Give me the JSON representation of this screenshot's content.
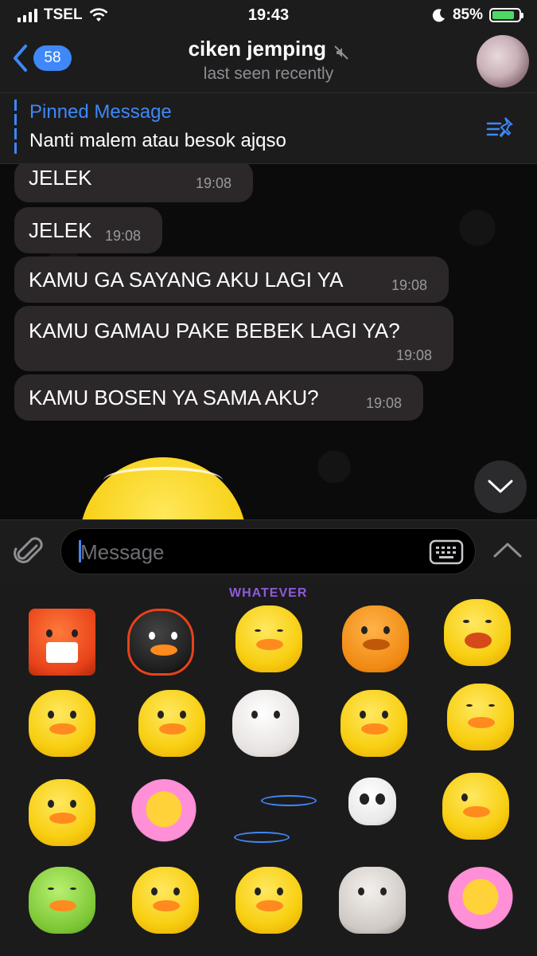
{
  "status_bar": {
    "carrier": "TSEL",
    "time": "19:43",
    "battery_percent": "85%",
    "battery_level": 0.85,
    "icons": [
      "signal-icon",
      "wifi-icon",
      "moon-icon",
      "battery-charging-icon"
    ]
  },
  "header": {
    "back_count": "58",
    "title": "ciken jemping",
    "subtitle": "last seen recently",
    "icons": [
      "back-chevron-icon",
      "mute-icon",
      "avatar"
    ]
  },
  "pinned": {
    "title": "Pinned Message",
    "text": "Nanti malem atau besok ajqso",
    "icon": "pin-list-icon"
  },
  "messages": [
    {
      "text": "JELEK",
      "time": "19:08"
    },
    {
      "text": "JELEK",
      "time": "19:08"
    },
    {
      "text": "KAMU GA SAYANG AKU LAGI YA",
      "time": "19:08"
    },
    {
      "text": "KAMU GAMAU PAKE BEBEK LAGI YA?",
      "time": "19:08"
    },
    {
      "text": "KAMU BOSEN YA SAMA AKU?",
      "time": "19:08"
    }
  ],
  "input": {
    "placeholder": "Message",
    "icons": [
      "paperclip-icon",
      "keyboard-icon",
      "chevron-up-icon",
      "chevron-down-icon"
    ]
  },
  "stickers": {
    "whatever_label": "WHATEVER",
    "items": [
      "angry-box-monster",
      "black-duck-fire",
      "whatever-duck",
      "angry-orange-duck",
      "laughing-duck",
      "crying-duck",
      "heart-duck",
      "crying-white-cat",
      "sick-duck",
      "sleepy-duck",
      "sad-tear-duck",
      "dizzy-flower",
      "ripple-rings",
      "skeleton",
      "thumbs-up-duck",
      "green-duck",
      "reading-duck",
      "umbrella-duck",
      "grey-dog",
      "flower-pot"
    ]
  },
  "colors": {
    "accent": "#3e88f7",
    "bubble": "#2c2829",
    "bar": "#1c1c1d",
    "background": "#000000"
  }
}
